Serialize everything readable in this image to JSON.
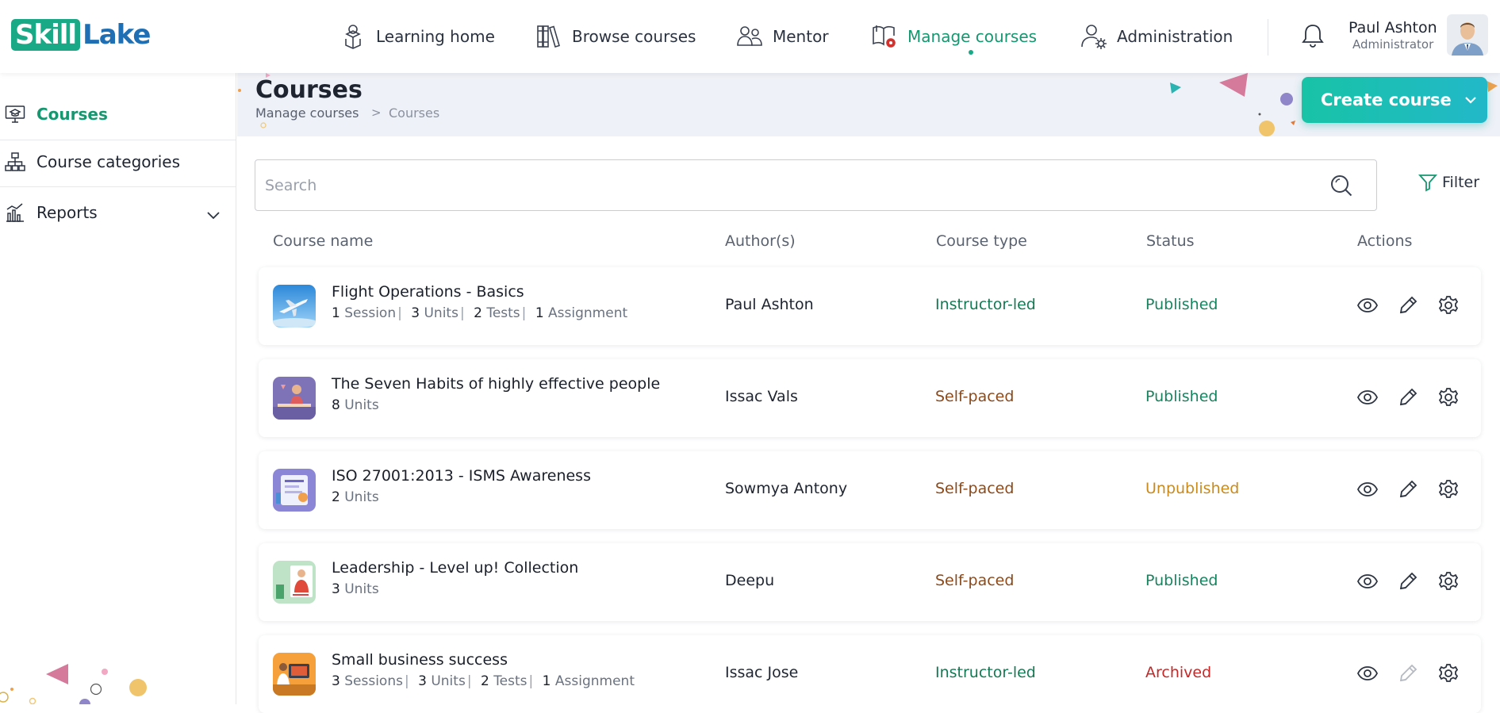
{
  "logo": {
    "part1": "Skill",
    "part2": "Lake"
  },
  "nav": [
    {
      "label": "Learning home",
      "icon": "student-icon"
    },
    {
      "label": "Browse courses",
      "icon": "books-icon"
    },
    {
      "label": "Mentor",
      "icon": "mentor-icon"
    },
    {
      "label": "Manage courses",
      "icon": "manage-book-icon",
      "active": true
    },
    {
      "label": "Administration",
      "icon": "admin-user-icon"
    }
  ],
  "user": {
    "name": "Paul Ashton",
    "role": "Administrator"
  },
  "sidebar": {
    "items": [
      {
        "label": "Courses",
        "icon": "monitor-cap-icon",
        "active": true
      },
      {
        "label": "Course categories",
        "icon": "hierarchy-icon"
      },
      {
        "label": "Reports",
        "icon": "bar-chart-icon",
        "expandable": true
      }
    ]
  },
  "page": {
    "title": "Courses",
    "breadcrumb": [
      "Manage courses",
      "Courses"
    ],
    "breadcrumb_sep": ">",
    "create_button": "Create course"
  },
  "search": {
    "placeholder": "Search",
    "value": ""
  },
  "filter": {
    "label": "Filter"
  },
  "table": {
    "headers": [
      "Course name",
      "Author(s)",
      "Course type",
      "Status",
      "Actions"
    ],
    "rows": [
      {
        "name": "Flight Operations - Basics",
        "meta": [
          {
            "n": "1",
            "unit": "Session"
          },
          {
            "n": "3",
            "unit": "Units"
          },
          {
            "n": "2",
            "unit": "Tests"
          },
          {
            "n": "1",
            "unit": "Assignment"
          }
        ],
        "author": "Paul Ashton",
        "type": "Instructor-led",
        "status": "Published",
        "thumb": "airplane"
      },
      {
        "name": "The Seven Habits of highly effective people",
        "meta": [
          {
            "n": "8",
            "unit": "Units"
          }
        ],
        "author": "Issac Vals",
        "type": "Self-paced",
        "status": "Published",
        "thumb": "person-desk"
      },
      {
        "name": "ISO 27001:2013 - ISMS Awareness",
        "meta": [
          {
            "n": "2",
            "unit": "Units"
          }
        ],
        "author": "Sowmya Antony",
        "type": "Self-paced",
        "status": "Unpublished",
        "thumb": "security-board"
      },
      {
        "name": "Leadership - Level up! Collection",
        "meta": [
          {
            "n": "3",
            "unit": "Units"
          }
        ],
        "author": "Deepu",
        "type": "Self-paced",
        "status": "Published",
        "thumb": "leader"
      },
      {
        "name": "Small business success",
        "meta": [
          {
            "n": "3",
            "unit": "Sessions"
          },
          {
            "n": "3",
            "unit": "Units"
          },
          {
            "n": "2",
            "unit": "Tests"
          },
          {
            "n": "1",
            "unit": "Assignment"
          }
        ],
        "author": "Issac Jose",
        "type": "Instructor-led",
        "status": "Archived",
        "thumb": "business"
      }
    ]
  },
  "colors": {
    "accent": "#17976f",
    "published": "#17845f",
    "unpublished": "#c98a1e",
    "archived": "#c62828",
    "instructor_led": "#137a55",
    "self_paced": "#8a4a1c"
  }
}
